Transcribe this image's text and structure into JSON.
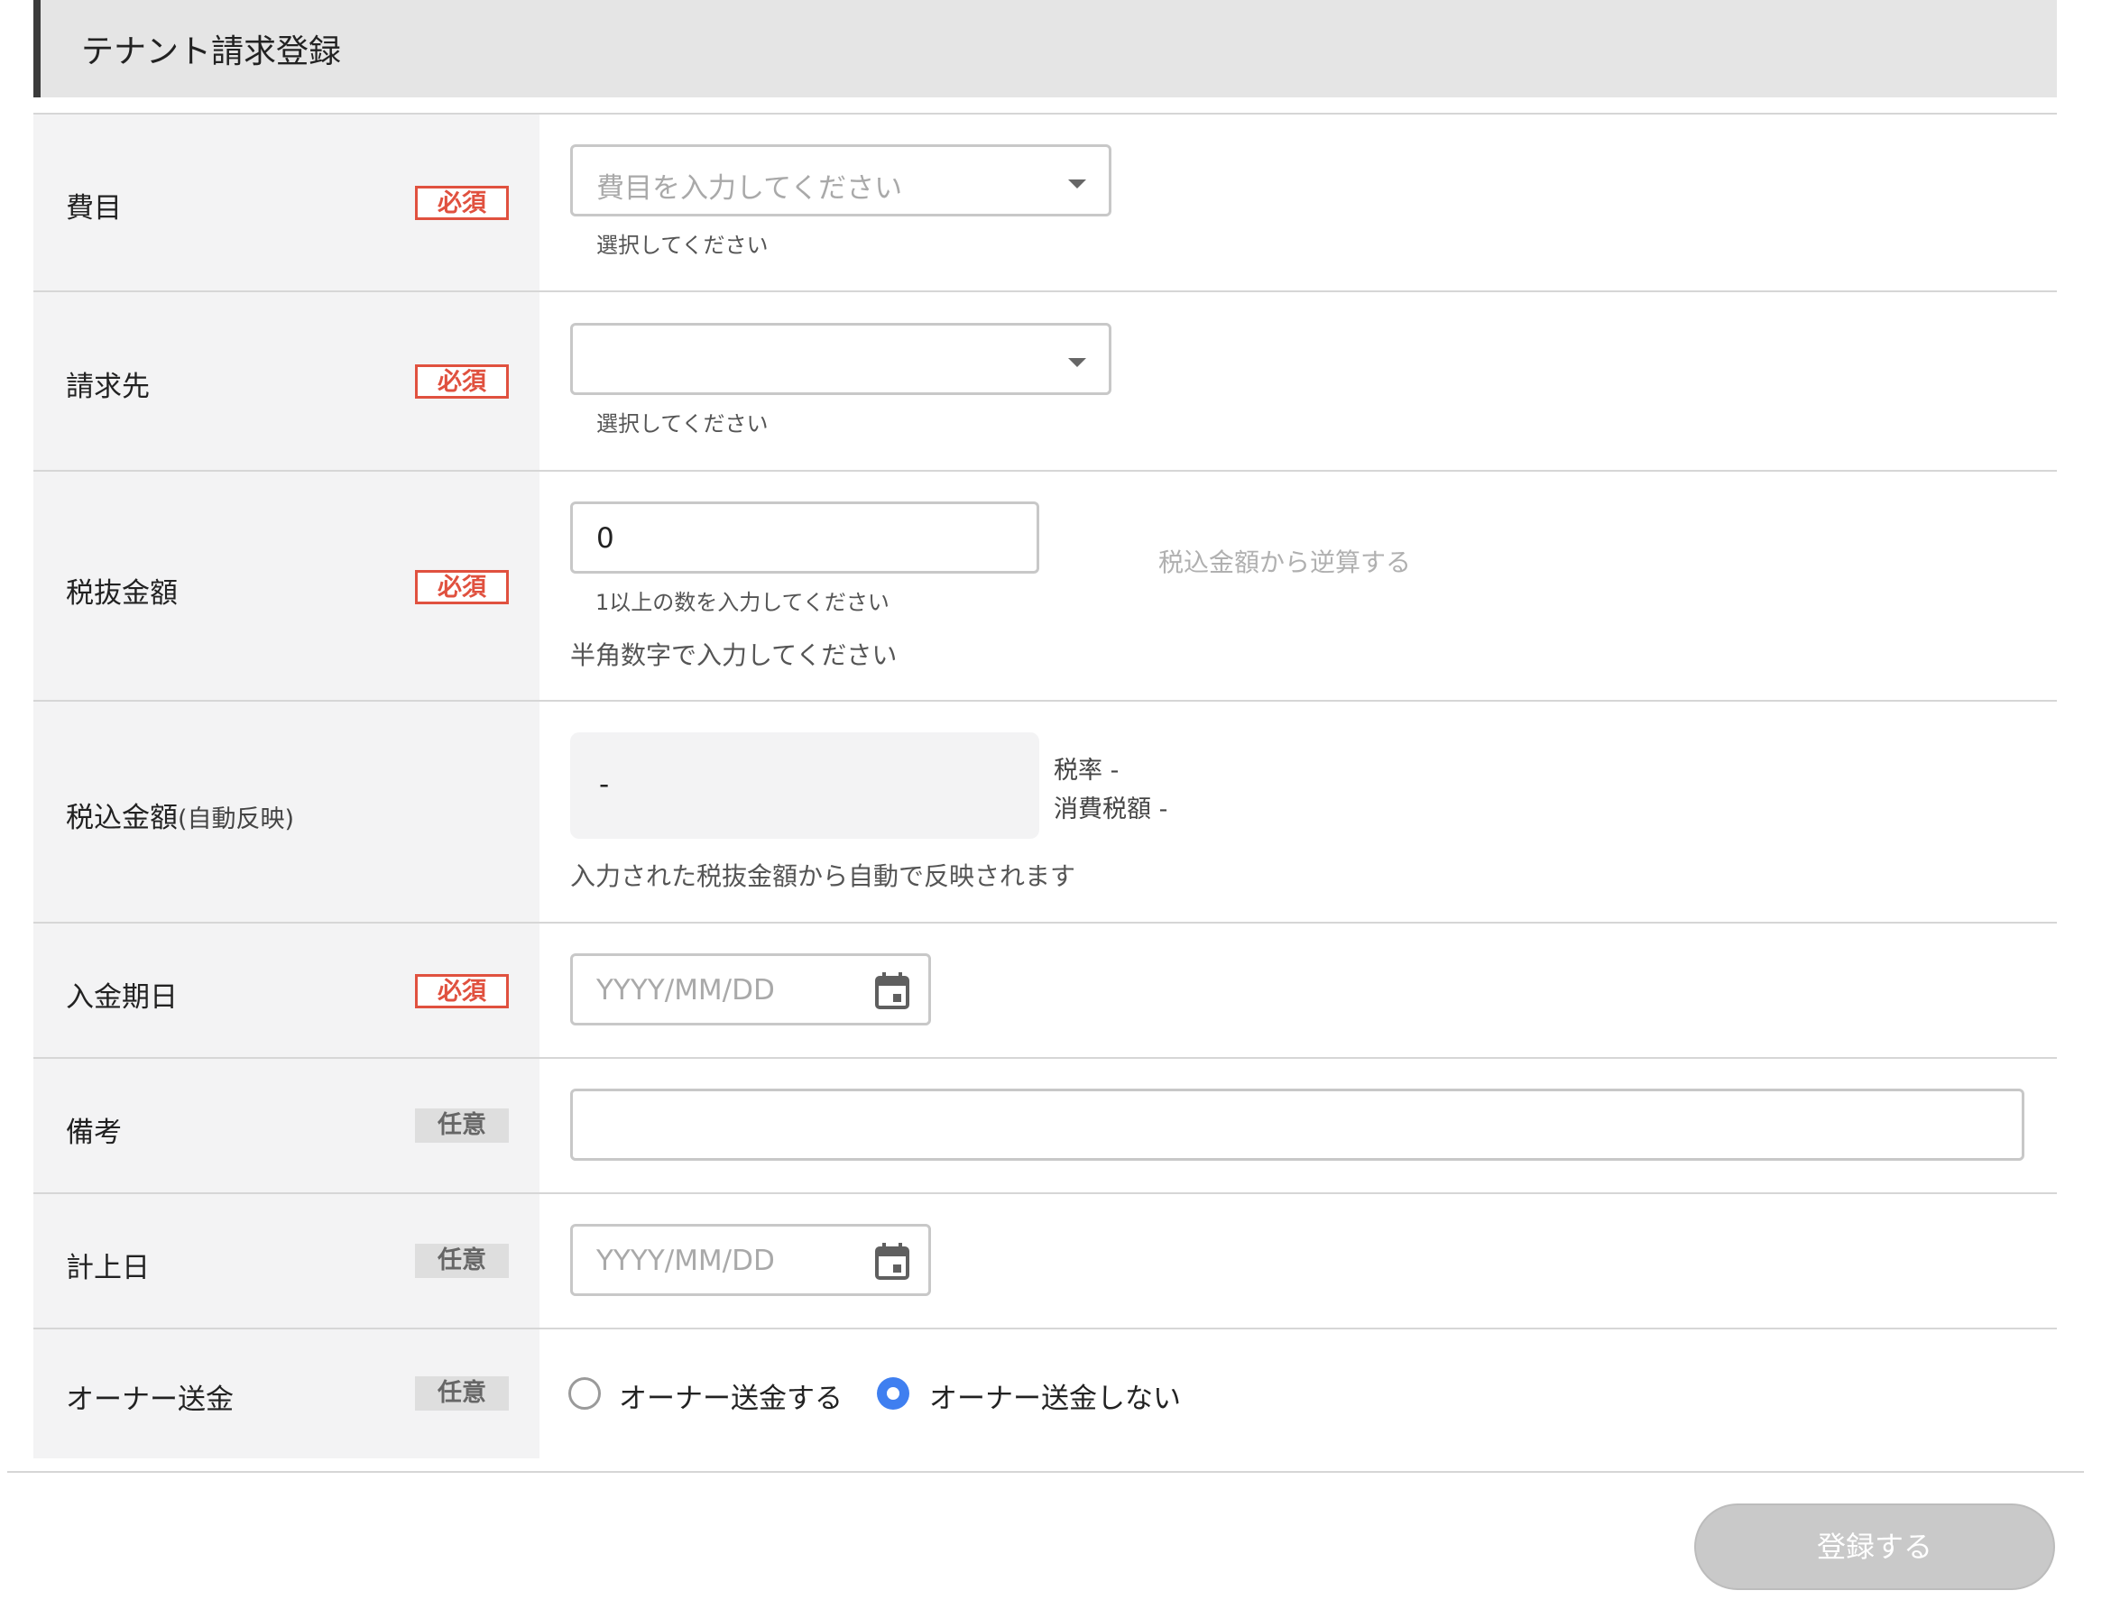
{
  "header": {
    "title": "テナント請求登録"
  },
  "badges": {
    "required": "必須",
    "optional": "任意"
  },
  "fields": {
    "expense_item": {
      "label": "費目",
      "placeholder": "費目を入力してください",
      "help": "選択してください",
      "icon": "chevron-down-icon"
    },
    "billing_to": {
      "label": "請求先",
      "value": "",
      "help": "選択してください",
      "icon": "chevron-down-icon"
    },
    "amount_excl_tax": {
      "label": "税抜金額",
      "value": "0",
      "help": "1以上の数を入力してください",
      "note": "半角数字で入力してください",
      "reverse_calc_link": "税込金額から逆算する"
    },
    "amount_incl_tax": {
      "label": "税込金額",
      "label_suffix": "(自動反映)",
      "value": "-",
      "tax_rate": "税率 -",
      "consumption_tax": "消費税額 -",
      "note": "入力された税抜金額から自動で反映されます"
    },
    "payment_due_date": {
      "label": "入金期日",
      "placeholder": "YYYY/MM/DD",
      "icon": "calendar-icon"
    },
    "remarks": {
      "label": "備考",
      "value": ""
    },
    "recorded_date": {
      "label": "計上日",
      "placeholder": "YYYY/MM/DD",
      "icon": "calendar-icon"
    },
    "owner_remittance": {
      "label": "オーナー送金",
      "options": [
        "オーナー送金する",
        "オーナー送金しない"
      ],
      "selected": "オーナー送金しない"
    }
  },
  "submit": {
    "label": "登録する"
  },
  "colors": {
    "required_red": "#e0513f",
    "radio_blue": "#3f7ff0",
    "label_bg": "#f3f3f4",
    "header_bg": "#e5e5e5"
  }
}
